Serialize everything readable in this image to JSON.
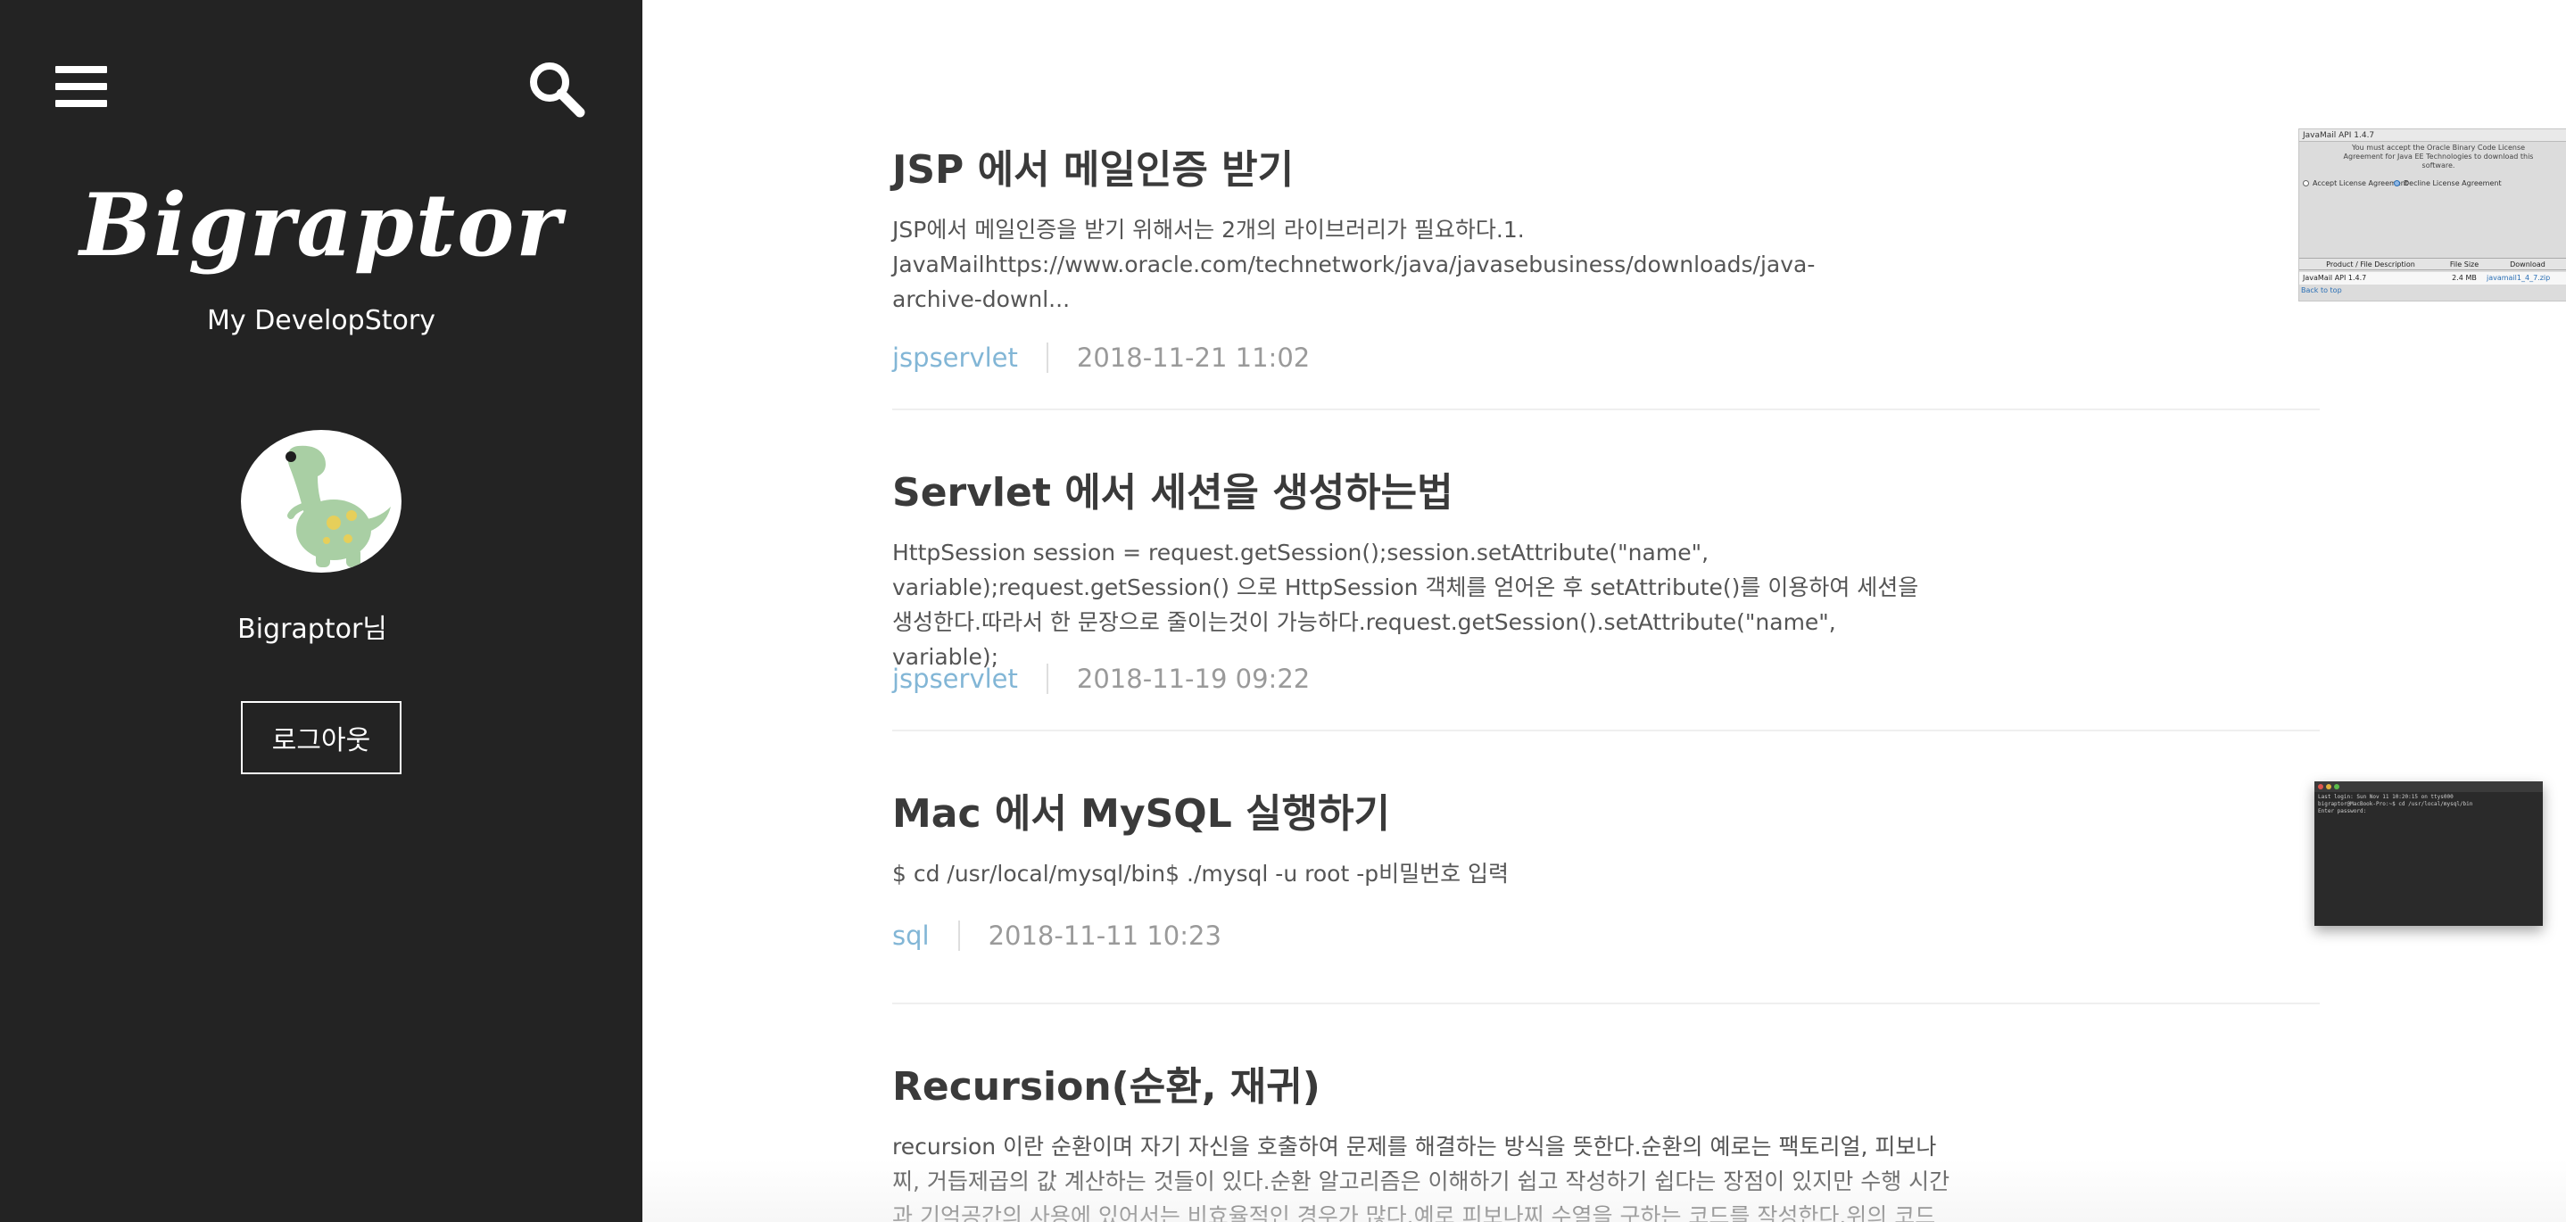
{
  "sidebar": {
    "menu_icon": "hamburger-menu-icon",
    "search_icon": "search-icon",
    "blog_title": "Bigraptor",
    "blog_description": "My DevelopStory",
    "avatar_icon": "dinosaur-avatar",
    "username": "Bigraptor님",
    "logout_label": "로그아웃",
    "background_color": "#232323"
  },
  "posts": [
    {
      "title": "JSP 에서 메일인증 받기",
      "summary": "JSP에서 메일인증을 받기 위해서는 2개의 라이브러리가 필요하다.1. JavaMailhttps://www.oracle.com/technetwork/java/javasebusiness/downloads/java-archive-downl...",
      "category": "jspservlet",
      "date": "2018-11-21 11:02",
      "thumbnail": {
        "title": "JavaMail API 1.4.7",
        "notice": "You must accept the Oracle Binary Code License Agreement for Java EE Technologies to download this software.",
        "accept": "Accept License Agreement",
        "decline": "Decline License Agreement",
        "col_product": "Product / File Description",
        "col_size": "File Size",
        "col_download": "Download",
        "row_product": "JavaMail API 1.4.7",
        "row_size": "2.4 MB",
        "row_download": "javamail1_4_7.zip",
        "back_link": "Back to top"
      }
    },
    {
      "title": "Servlet 에서 세션을 생성하는법",
      "summary": "HttpSession session = request.getSession();session.setAttribute(\"name\", variable);request.getSession() 으로 HttpSession 객체를 얻어온 후 setAttribute()를 이용하여 세션을 생성한다.따라서 한 문장으로 줄이는것이 가능하다.request.getSession().setAttribute(\"name\", variable);",
      "category": "jspservlet",
      "date": "2018-11-19 09:22"
    },
    {
      "title": "Mac 에서 MySQL 실행하기",
      "summary": "$ cd /usr/local/mysql/bin$ ./mysql -u root -p비밀번호 입력",
      "category": "sql",
      "date": "2018-11-11 10:23",
      "thumbnail": {
        "line1": "Last login: Sun Nov 11 10:20:15 on ttys000",
        "line2": "bigraptor@MacBook-Pro:~$ cd /usr/local/mysql/bin",
        "line3": "Enter password:"
      }
    },
    {
      "title": "Recursion(순환, 재귀)",
      "summary": "recursion 이란 순환이며 자기 자신을 호출하여 문제를 해결하는 방식을 뜻한다.순환의 예로는 팩토리얼, 피보나찌, 거듭제곱의 값 계산하는 것들이 있다.순환 알고리즘은 이해하기 쉽고 작성하기 쉽다는 장점이 있지만 수행 시간과 기억공간의 사용에 있어서는 비효율적인 경우가 많다.예로 피보나찌 수열을 구하는 코드를 작성한다.위의 코드는 피..."
    }
  ],
  "colors": {
    "category_link": "#82b6d6",
    "date_text": "#9a9a9a",
    "title_text": "#3a3a3a",
    "summary_text": "#555555"
  }
}
